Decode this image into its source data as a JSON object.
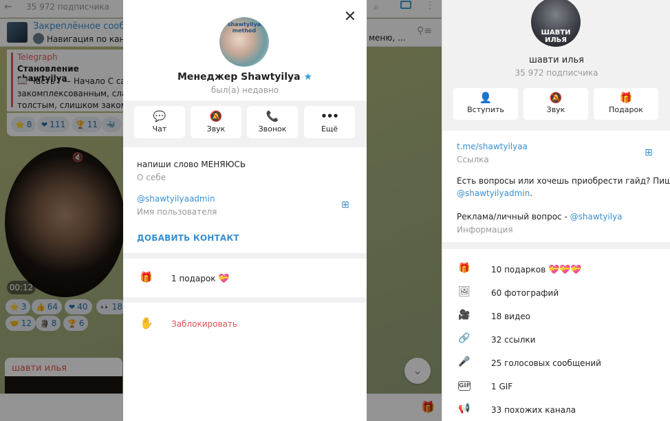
{
  "chat": {
    "subscribers": "35 972 подписчика",
    "pinned_title": "Закреплённое сообще",
    "pinned_text": "Навигация по канал",
    "pinned_tail": "меню, ...",
    "post": {
      "source": "Telegraph",
      "title": "Становление shawtyilya",
      "line1": "📖 Часть I — Начало С сам",
      "line2": "закомплексованным, слабы",
      "line3": "толстым, слишком закомпл"
    },
    "reactions1": [
      {
        "icon": "⭐",
        "count": "8"
      },
      {
        "icon": "❤",
        "count": "111"
      },
      {
        "icon": "🏆",
        "count": "11"
      },
      {
        "icon": "🐳",
        "count": ""
      }
    ],
    "video_duration": "00:12",
    "reactions2": [
      {
        "icon": "⭐",
        "count": "3"
      },
      {
        "icon": "👍",
        "count": "64"
      },
      {
        "icon": "❤",
        "count": "40"
      },
      {
        "icon": "👀",
        "count": "18"
      }
    ],
    "reactions3": [
      {
        "icon": "🤝",
        "count": "12"
      },
      {
        "icon": "🗿",
        "count": "8"
      },
      {
        "icon": "🏆",
        "count": "6"
      }
    ],
    "next_author": "шавти илья"
  },
  "modal": {
    "name": "Менеджер Shawtyilya",
    "status": "был(а) недавно",
    "avatar_text": "shawtyilya method",
    "actions": [
      {
        "icon": "chat-icon",
        "glyph": "💬",
        "label": "Чат"
      },
      {
        "icon": "mute-icon",
        "glyph": "🔕",
        "label": "Звук"
      },
      {
        "icon": "phone-icon",
        "glyph": "📞",
        "label": "Звонок"
      },
      {
        "icon": "more-icon",
        "glyph": "•••",
        "label": "Ещё"
      }
    ],
    "about": "напиши слово МЕНЯЮСЬ",
    "about_caption": "О себе",
    "username": "@shawtyilyaadmin",
    "username_caption": "Имя пользователя",
    "add_contact": "ДОБАВИТЬ КОНТАКТ",
    "gifts": "1 подарок",
    "block": "Заблокировать"
  },
  "channel": {
    "avatar_text": "ШАВТИ ИЛЬЯ",
    "name": "шавти илья",
    "subscribers": "35 972 подписчика",
    "actions": [
      {
        "icon": "join-icon",
        "glyph": "👤",
        "label": "Вступить"
      },
      {
        "icon": "mute-icon",
        "glyph": "🔕",
        "label": "Звук"
      },
      {
        "icon": "gift-icon",
        "glyph": "🎁",
        "label": "Подарок"
      }
    ],
    "link": "t.me/shawtyilyaa",
    "link_caption": "Ссылка",
    "desc_line1": "Есть вопросы или хочешь приобрести гайд? Пиши:",
    "desc_line2": "@shawtyilyadmin",
    "desc_line3_prefix": "Реклама/личный вопрос - ",
    "desc_line3_user": "@shawtyilya",
    "info_caption": "Информация",
    "stats": [
      {
        "icon": "gift-icon",
        "glyph": "🎁",
        "label": "10 подарков"
      },
      {
        "icon": "photo-icon",
        "glyph": "🖼",
        "label": "60 фотографий"
      },
      {
        "icon": "video-icon",
        "glyph": "🎥",
        "label": "18 видео"
      },
      {
        "icon": "link-icon",
        "glyph": "🔗",
        "label": "32 ссылки"
      },
      {
        "icon": "mic-icon",
        "glyph": "🎤",
        "label": "25 голосовых сообщений"
      },
      {
        "icon": "gif-icon",
        "glyph": "GIF",
        "label": "1 GIF"
      },
      {
        "icon": "megaphone-icon",
        "glyph": "📢",
        "label": "33 похожих канала"
      }
    ]
  },
  "colors": {
    "accent": "#3a8fd0",
    "danger": "#e15151",
    "verified": "#3a9cdb"
  }
}
